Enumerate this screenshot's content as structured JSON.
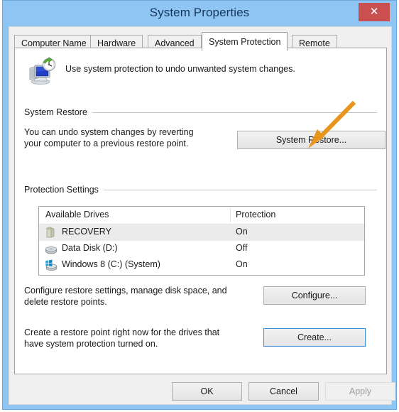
{
  "window": {
    "title": "System Properties",
    "close_label": "✕"
  },
  "tabs": [
    {
      "label": "Computer Name",
      "active": false
    },
    {
      "label": "Hardware",
      "active": false
    },
    {
      "label": "Advanced",
      "active": false
    },
    {
      "label": "System Protection",
      "active": true
    },
    {
      "label": "Remote",
      "active": false
    }
  ],
  "header": {
    "icon": "system-restore-monitor-clock-icon",
    "description": "Use system protection to undo unwanted system changes."
  },
  "system_restore": {
    "group_label": "System Restore",
    "description_line1": "You can undo system changes by reverting",
    "description_line2": "your computer to a previous restore point.",
    "button_label": "System Restore..."
  },
  "protection_settings": {
    "group_label": "Protection Settings",
    "columns": [
      "Available Drives",
      "Protection"
    ],
    "rows": [
      {
        "icon": "recovery-drive-icon",
        "name": "RECOVERY",
        "protection": "On",
        "selected": true
      },
      {
        "icon": "hard-disk-icon",
        "name": "Data Disk (D:)",
        "protection": "Off",
        "selected": false
      },
      {
        "icon": "windows-system-drive-icon",
        "name": "Windows 8 (C:) (System)",
        "protection": "On",
        "selected": false
      }
    ],
    "configure": {
      "description_line1": "Configure restore settings, manage disk space, and",
      "description_line2": "delete restore points.",
      "button_label": "Configure..."
    },
    "create": {
      "description_line1": "Create a restore point right now for the drives that",
      "description_line2": "have system protection turned on.",
      "button_label": "Create..."
    }
  },
  "footer": {
    "ok_label": "OK",
    "cancel_label": "Cancel",
    "apply_label": "Apply",
    "apply_disabled": true
  },
  "annotation": {
    "type": "arrow",
    "color": "#e8951e",
    "points_to": "System Restore..."
  },
  "colors": {
    "titlebar": "#8ec5f2",
    "close_button": "#c9504f",
    "dialog_background": "#f0f0f0",
    "tabpage_background": "#ffffff",
    "arrow": "#e8951e",
    "focus_border": "#3c8dd4"
  }
}
